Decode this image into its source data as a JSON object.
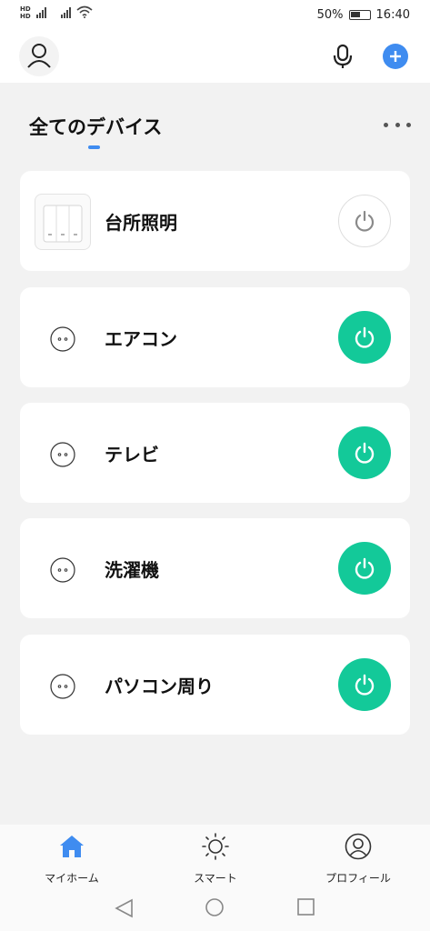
{
  "status_bar": {
    "hd_label": "HD",
    "battery": "50%",
    "time": "16:40"
  },
  "header": {
    "icons": [
      "user-icon",
      "microphone-icon",
      "plus-icon"
    ],
    "accent_color": "#3f8cf0"
  },
  "section": {
    "title": "全てのデバイス"
  },
  "devices": [
    {
      "name": "台所照明",
      "icon": "wall-switch-icon",
      "power": "off"
    },
    {
      "name": "エアコン",
      "icon": "socket-icon",
      "power": "on"
    },
    {
      "name": "テレビ",
      "icon": "socket-icon",
      "power": "on"
    },
    {
      "name": "洗濯機",
      "icon": "socket-icon",
      "power": "on"
    },
    {
      "name": "パソコン周り",
      "icon": "socket-icon",
      "power": "on"
    }
  ],
  "colors": {
    "power_on": "#13c999",
    "power_off": "#ffffff"
  },
  "bottom_nav": [
    {
      "label": "マイホーム",
      "icon": "home-icon",
      "active": true
    },
    {
      "label": "スマート",
      "icon": "sun-icon",
      "active": false
    },
    {
      "label": "プロフィール",
      "icon": "profile-icon",
      "active": false
    }
  ]
}
